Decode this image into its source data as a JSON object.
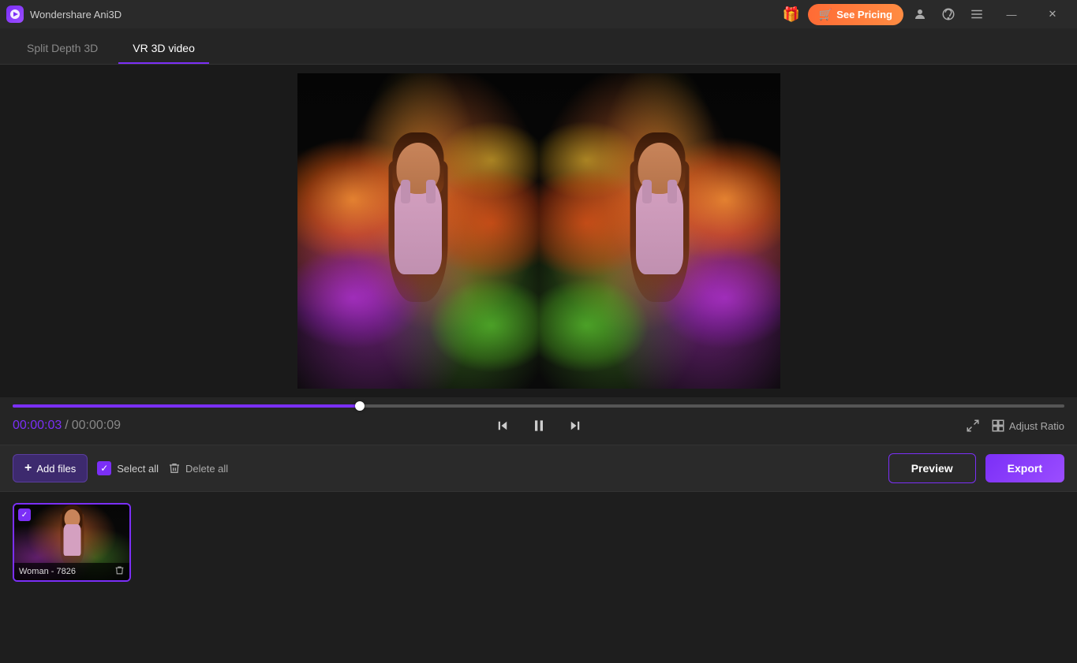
{
  "titlebar": {
    "logo_emoji": "▶",
    "app_name": "Wondershare Ani3D",
    "gift_icon": "🎁",
    "see_pricing_label": "See Pricing",
    "cart_icon": "🛒",
    "user_icon": "👤",
    "headset_icon": "🎧",
    "menu_icon": "≡",
    "minimize_icon": "—",
    "close_icon": "✕"
  },
  "tabs": [
    {
      "id": "split-depth",
      "label": "Split Depth 3D",
      "active": false
    },
    {
      "id": "vr-3d",
      "label": "VR 3D video",
      "active": true
    }
  ],
  "controls": {
    "time_current": "00:00:03",
    "time_separator": "/",
    "time_total": "00:00:09",
    "progress_pct": 33,
    "rewind_icon": "⏮",
    "pause_icon": "⏸",
    "forward_icon": "⏭",
    "fullscreen_icon": "⛶",
    "adjust_ratio_label": "Adjust Ratio",
    "ratio_icon": "⊞"
  },
  "toolbar": {
    "add_files_label": "Add files",
    "add_icon": "+",
    "select_all_label": "Select all",
    "delete_all_label": "Delete all",
    "preview_label": "Preview",
    "export_label": "Export"
  },
  "files": [
    {
      "id": "file-1",
      "name": "Woman - 7826",
      "checked": true
    }
  ],
  "colors": {
    "accent": "#7b2ff7",
    "accent_light": "#9b4dff",
    "orange": "#ff6b35",
    "bg_dark": "#1a1a1a",
    "bg_medium": "#252525",
    "bg_toolbar": "#2a2a2a"
  }
}
